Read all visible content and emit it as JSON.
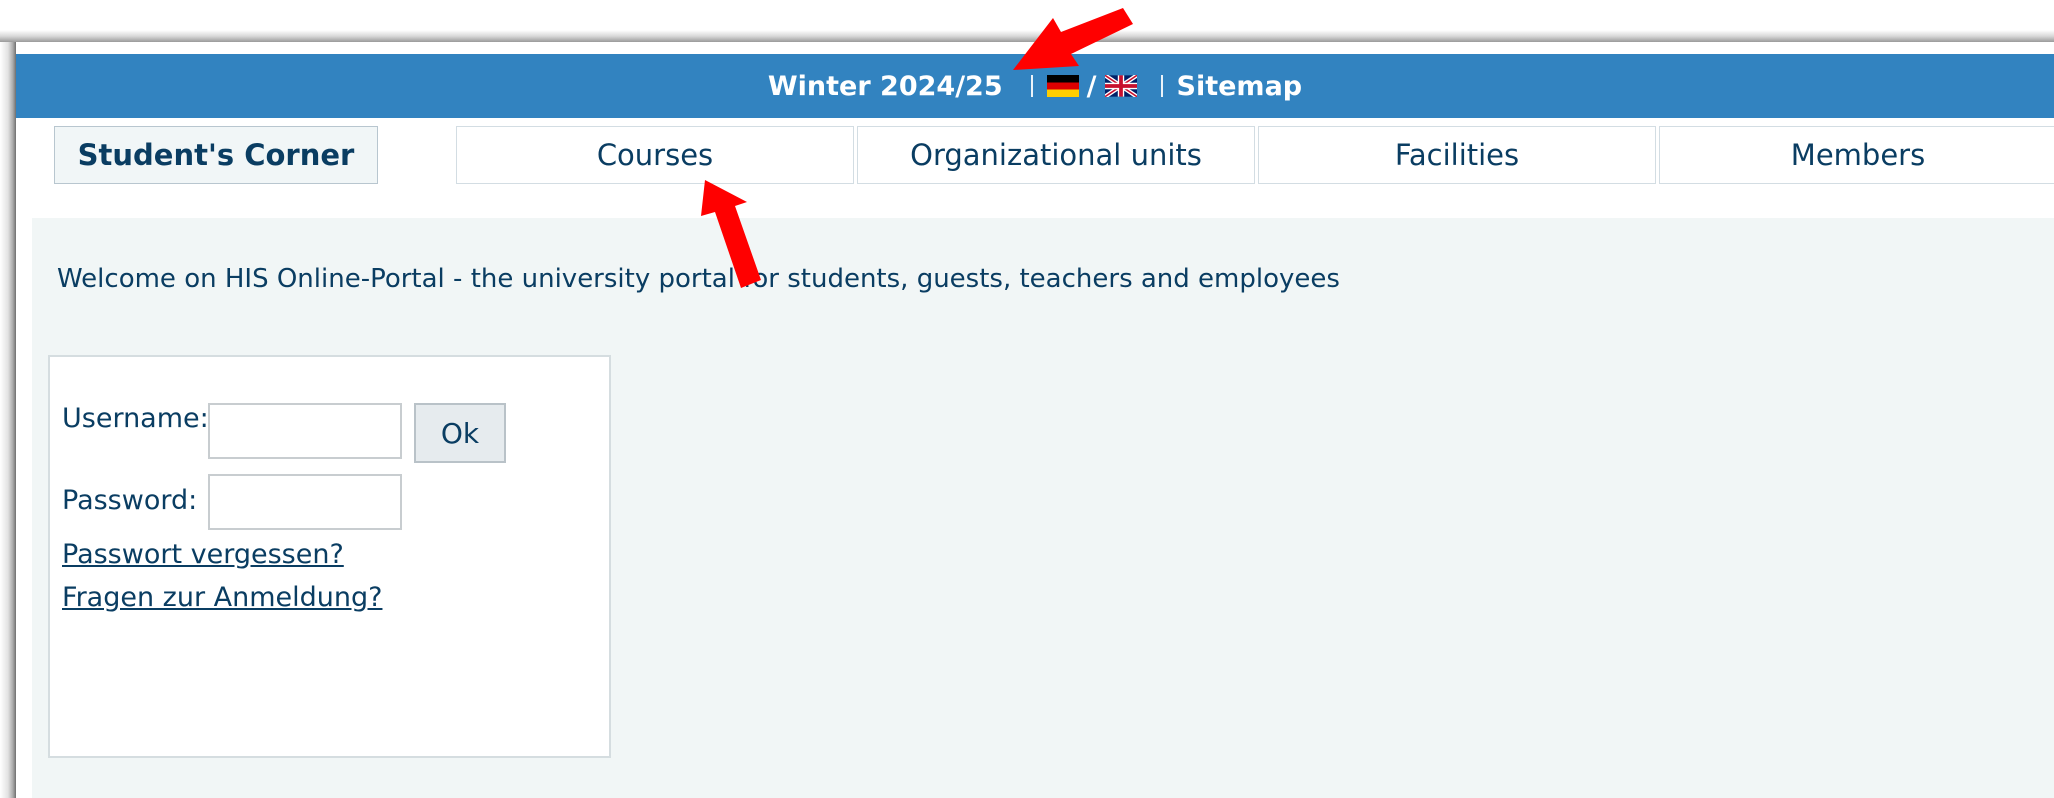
{
  "header": {
    "semester": "Winter 2024/25",
    "language_separator": "/",
    "sitemap": "Sitemap",
    "bar_color": "#3283c0"
  },
  "nav": {
    "tabs": [
      {
        "label": "Student's Corner",
        "active": true
      },
      {
        "label": "Courses",
        "active": false
      },
      {
        "label": "Organizational units",
        "active": false
      },
      {
        "label": "Facilities",
        "active": false
      },
      {
        "label": "Members",
        "active": false
      }
    ]
  },
  "main": {
    "welcome": "Welcome on HIS Online-Portal - the university portal for students, guests, teachers and employees",
    "login": {
      "username_label": "Username:",
      "password_label": "Password:",
      "username_value": "",
      "password_value": "",
      "ok_label": "Ok",
      "forgot_password": "Passwort vergessen?",
      "login_questions": "Fragen zur Anmeldung?"
    }
  },
  "annotations": {
    "arrow_color": "#ff0000",
    "arrow_icon": "red-arrow-icon"
  }
}
